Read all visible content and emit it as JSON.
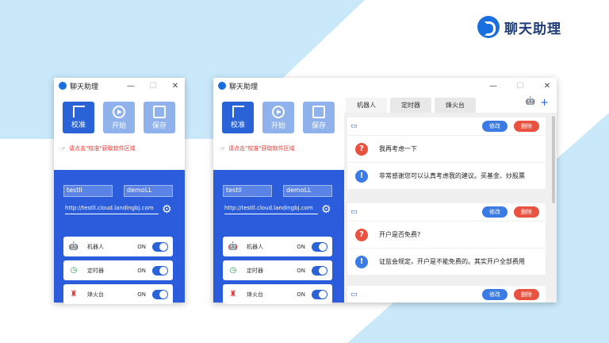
{
  "brand": {
    "name": "聊天助理"
  },
  "window": {
    "title": "聊天助理",
    "controls": [
      "—",
      "☐",
      "✕"
    ]
  },
  "toolbar": {
    "buttons": [
      {
        "label": "校准",
        "icon": "crop-icon"
      },
      {
        "label": "开始",
        "icon": "play-icon"
      },
      {
        "label": "保存",
        "icon": "save-icon"
      }
    ],
    "hint": "请点击\"校准\"获取软件区域"
  },
  "credentials": {
    "user": "testll",
    "name": "demoLL",
    "url": "http://testll.cloud.landingbj.com"
  },
  "features": [
    {
      "label": "机器人",
      "state": "ON",
      "icon": "robot-icon"
    },
    {
      "label": "定时器",
      "state": "ON",
      "icon": "timer-icon"
    },
    {
      "label": "烽火台",
      "state": "ON",
      "icon": "beacon-icon"
    }
  ],
  "tabs": [
    "机器人",
    "定时器",
    "烽火台"
  ],
  "card_actions": {
    "edit": "修改",
    "delete": "删除"
  },
  "qa_cards": [
    {
      "question": "我再考虑一下",
      "answer": "非常感谢您可以认真考虑我的建议。买基金、炒股票"
    },
    {
      "question": "开户是否免费?",
      "answer": "证监会规定，开户是不能免费的。其实开户全部费用"
    }
  ],
  "colors": {
    "primary": "#2b5cdc",
    "danger": "#e8523e",
    "accent": "#3a7be6"
  }
}
